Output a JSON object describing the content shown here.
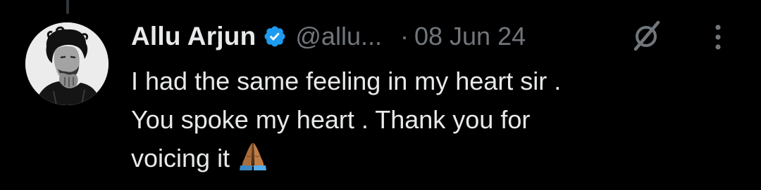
{
  "tweet": {
    "author_name": "Allu Arjun",
    "handle": "@allu...",
    "separator": "·",
    "date": "08 Jun 24",
    "text": "I had the same feeling in my heart sir .\nYou spoke my heart . Thank you for\nvoicing it",
    "emoji": "folded-hands-emoji",
    "verified": true
  },
  "icons": {
    "verified": "verified-badge-icon",
    "grok": "grok-icon",
    "more": "more-options-icon",
    "avatar": "profile-avatar"
  },
  "colors": {
    "background": "#000000",
    "primary_text": "#e7e9ea",
    "secondary_text": "#71767b",
    "verified_blue": "#1d9bf0",
    "thread_line": "#333639"
  }
}
